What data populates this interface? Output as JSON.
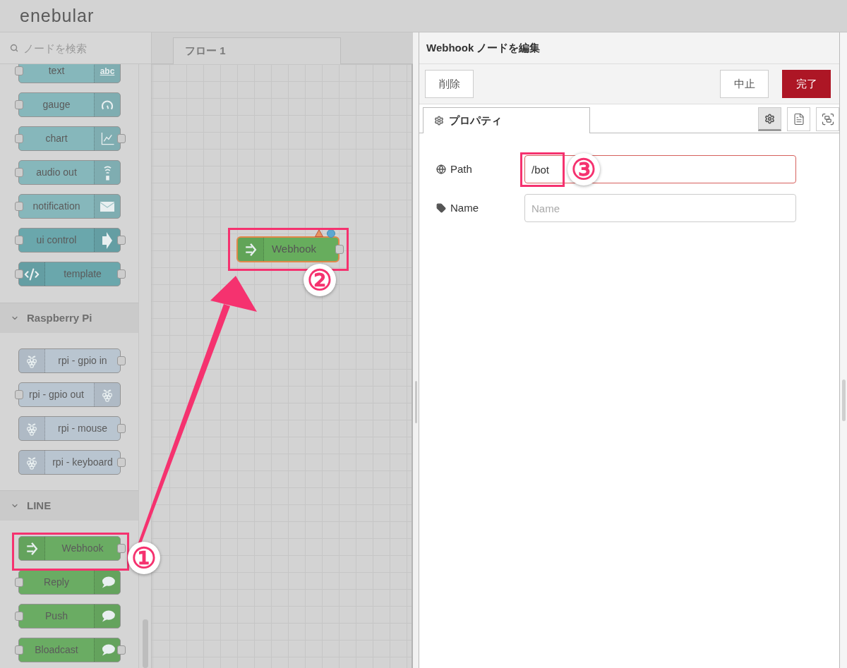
{
  "header": {
    "logo": "enebular"
  },
  "palette": {
    "search": {
      "placeholder": "ノードを検索"
    },
    "categories": [
      {
        "nodes": [
          {
            "label": "text",
            "kind": "text",
            "icon_label": "abc",
            "icon_left": false,
            "input": true,
            "output": false,
            "color": "#86b7bb"
          },
          {
            "label": "gauge",
            "kind": "gauge",
            "icon_left": false,
            "input": true,
            "output": false,
            "color": "#86b7bb"
          },
          {
            "label": "chart",
            "kind": "chart",
            "icon_left": false,
            "input": true,
            "output": true,
            "color": "#86b7bb"
          },
          {
            "label": "audio out",
            "kind": "audio",
            "icon_left": false,
            "input": true,
            "output": false,
            "color": "#86b7bb"
          },
          {
            "label": "notification",
            "kind": "notification",
            "icon_left": false,
            "input": true,
            "output": false,
            "color": "#86b7bb"
          },
          {
            "label": "ui control",
            "kind": "control",
            "icon_left": false,
            "input": true,
            "output": true,
            "color": "#6aa7ac"
          },
          {
            "label": "template",
            "kind": "template",
            "icon_left": true,
            "input": true,
            "output": true,
            "color": "#6aa7ac"
          }
        ]
      },
      {
        "title": "Raspberry Pi",
        "expanded": true,
        "nodes": [
          {
            "label": "rpi - gpio in",
            "kind": "rpi",
            "icon_left": true,
            "input": false,
            "output": true,
            "color": "#b9c5d0"
          },
          {
            "label": "rpi - gpio out",
            "kind": "rpi",
            "icon_left": false,
            "input": true,
            "output": false,
            "color": "#b9c5d0"
          },
          {
            "label": "rpi - mouse",
            "kind": "rpi",
            "icon_left": true,
            "input": false,
            "output": true,
            "color": "#b9c5d0"
          },
          {
            "label": "rpi - keyboard",
            "kind": "rpi",
            "icon_left": true,
            "input": false,
            "output": true,
            "color": "#b9c5d0"
          }
        ]
      },
      {
        "title": "LINE",
        "expanded": true,
        "nodes": [
          {
            "label": "Webhook",
            "kind": "webhook",
            "icon_left": true,
            "input": false,
            "output": true,
            "color": "#6aac63"
          },
          {
            "label": "Reply",
            "kind": "message",
            "icon_left": false,
            "input": true,
            "output": false,
            "color": "#6aac63"
          },
          {
            "label": "Push",
            "kind": "message",
            "icon_left": false,
            "input": true,
            "output": false,
            "color": "#6aac63"
          },
          {
            "label": "Bloadcast",
            "kind": "message",
            "icon_left": false,
            "input": true,
            "output": true,
            "color": "#6aac63"
          }
        ]
      }
    ]
  },
  "workspace": {
    "tabs": [
      {
        "label": "フロー 1",
        "selected": true
      }
    ],
    "nodes": [
      {
        "label": "Webhook",
        "kind": "webhook",
        "icon_left": true,
        "color": "#67ad5d",
        "selected": true,
        "invalid": true,
        "changed": true,
        "input": false,
        "output": true
      }
    ]
  },
  "editor": {
    "title": "Webhook ノードを編集",
    "buttons": [
      {
        "label": "削除",
        "kind": "plain"
      },
      {
        "label": "中止",
        "kind": "plain"
      },
      {
        "label": "完了",
        "kind": "primary"
      }
    ],
    "tabs": [
      {
        "label": "プロパティ",
        "selected": true
      }
    ],
    "view_buttons": [
      {
        "kind": "properties",
        "selected": true
      },
      {
        "kind": "description",
        "selected": false
      },
      {
        "kind": "appearance",
        "selected": false
      }
    ],
    "fields": [
      {
        "label": "Path",
        "kind": "path",
        "value": "/bot",
        "invalid": true
      },
      {
        "label": "Name",
        "kind": "name",
        "placeholder": "Name",
        "invalid": false
      }
    ]
  },
  "annotations": [
    {
      "label": "①"
    },
    {
      "label": "②"
    },
    {
      "label": "③"
    }
  ]
}
